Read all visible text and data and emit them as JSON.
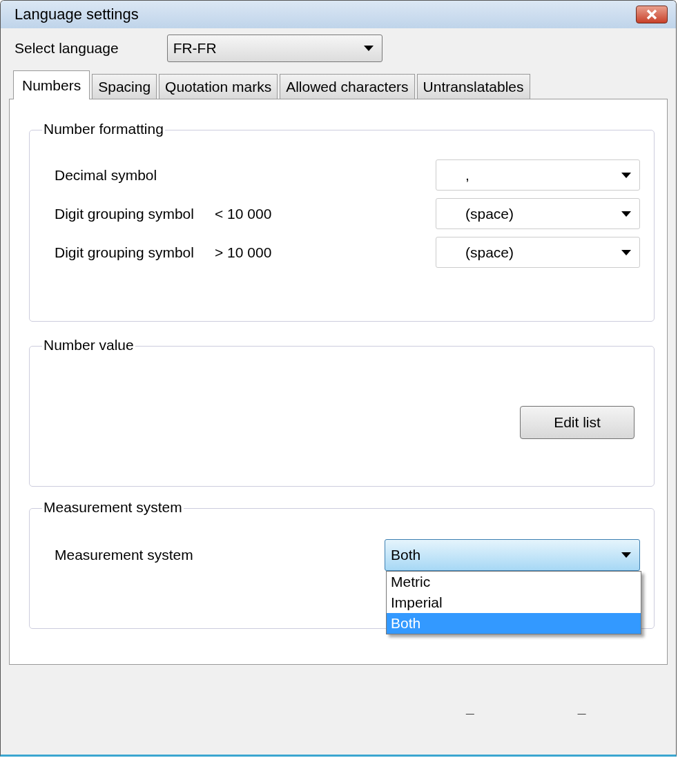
{
  "window": {
    "title": "Language settings"
  },
  "language": {
    "label": "Select language",
    "value": "FR-FR"
  },
  "tabs": [
    {
      "label": "Numbers",
      "selected": true
    },
    {
      "label": "Spacing",
      "selected": false
    },
    {
      "label": "Quotation marks",
      "selected": false
    },
    {
      "label": "Allowed characters",
      "selected": false
    },
    {
      "label": "Untranslatables",
      "selected": false
    }
  ],
  "number_formatting": {
    "title": "Number formatting",
    "rows": [
      {
        "label": "Decimal symbol",
        "value": ","
      },
      {
        "label": "Digit grouping symbol",
        "condition": "< 10 000",
        "value": "(space)"
      },
      {
        "label": "Digit grouping symbol",
        "condition": "> 10 000",
        "value": "(space)"
      }
    ]
  },
  "number_value": {
    "title": "Number value",
    "button": "Edit list"
  },
  "measurement": {
    "title": "Measurement system",
    "label": "Measurement system",
    "value": "Both",
    "options": [
      {
        "label": "Metric",
        "selected": false
      },
      {
        "label": "Imperial",
        "selected": false
      },
      {
        "label": "Both",
        "selected": true
      }
    ]
  },
  "footer": [
    "_",
    "_"
  ]
}
